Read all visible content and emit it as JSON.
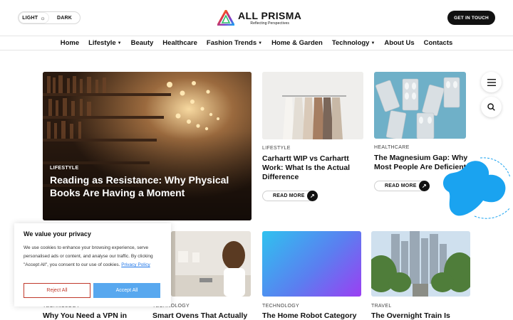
{
  "header": {
    "theme_light": "LIGHT",
    "theme_dark": "DARK",
    "logo_name": "ALL PRISMA",
    "logo_tagline": "Reflecting Perspectives",
    "cta": "GET IN TOUCH"
  },
  "nav": {
    "items": [
      {
        "label": "Home"
      },
      {
        "label": "Lifestyle"
      },
      {
        "label": "Beauty"
      },
      {
        "label": "Healthcare"
      },
      {
        "label": "Fashion Trends"
      },
      {
        "label": "Home & Garden"
      },
      {
        "label": "Technology"
      },
      {
        "label": "About Us"
      },
      {
        "label": "Contacts"
      }
    ]
  },
  "feature": {
    "category": "LIFESTYLE",
    "title": "Reading as Resistance: Why Physical Books Are Having a Moment"
  },
  "cards": [
    {
      "category": "LIFESTYLE",
      "title": "Carhartt WIP vs Carhartt Work: What Is the Actual Difference",
      "read_more": "READ MORE"
    },
    {
      "category": "HEALTHCARE",
      "title": "The Magnesium Gap: Why Most People Are Deficient",
      "read_more": "READ MORE"
    }
  ],
  "row2": [
    {
      "category": "TECHNOLOGY",
      "title": "Why You Need a VPN in"
    },
    {
      "category": "TECHNOLOGY",
      "title": "Smart Ovens That Actually"
    },
    {
      "category": "TECHNOLOGY",
      "title": "The Home Robot Category"
    },
    {
      "category": "TRAVEL",
      "title": "The Overnight Train Is"
    }
  ],
  "cookie": {
    "title": "We value your privacy",
    "text": "We use cookies to enhance your browsing experience, serve personalised ads or content, and analyse our traffic. By clicking \"Accept All\", you consent to our use of cookies.",
    "policy": "Privacy Policy",
    "reject": "Reject All",
    "accept": "Accept All"
  },
  "colors": {
    "accent_blob": "#1aa3f0",
    "accept": "#58a8ef",
    "reject": "#c0392b"
  },
  "icons": [
    "sun-icon",
    "menu-icon",
    "search-icon",
    "arrow-up-right-icon",
    "chevron-down-icon"
  ]
}
